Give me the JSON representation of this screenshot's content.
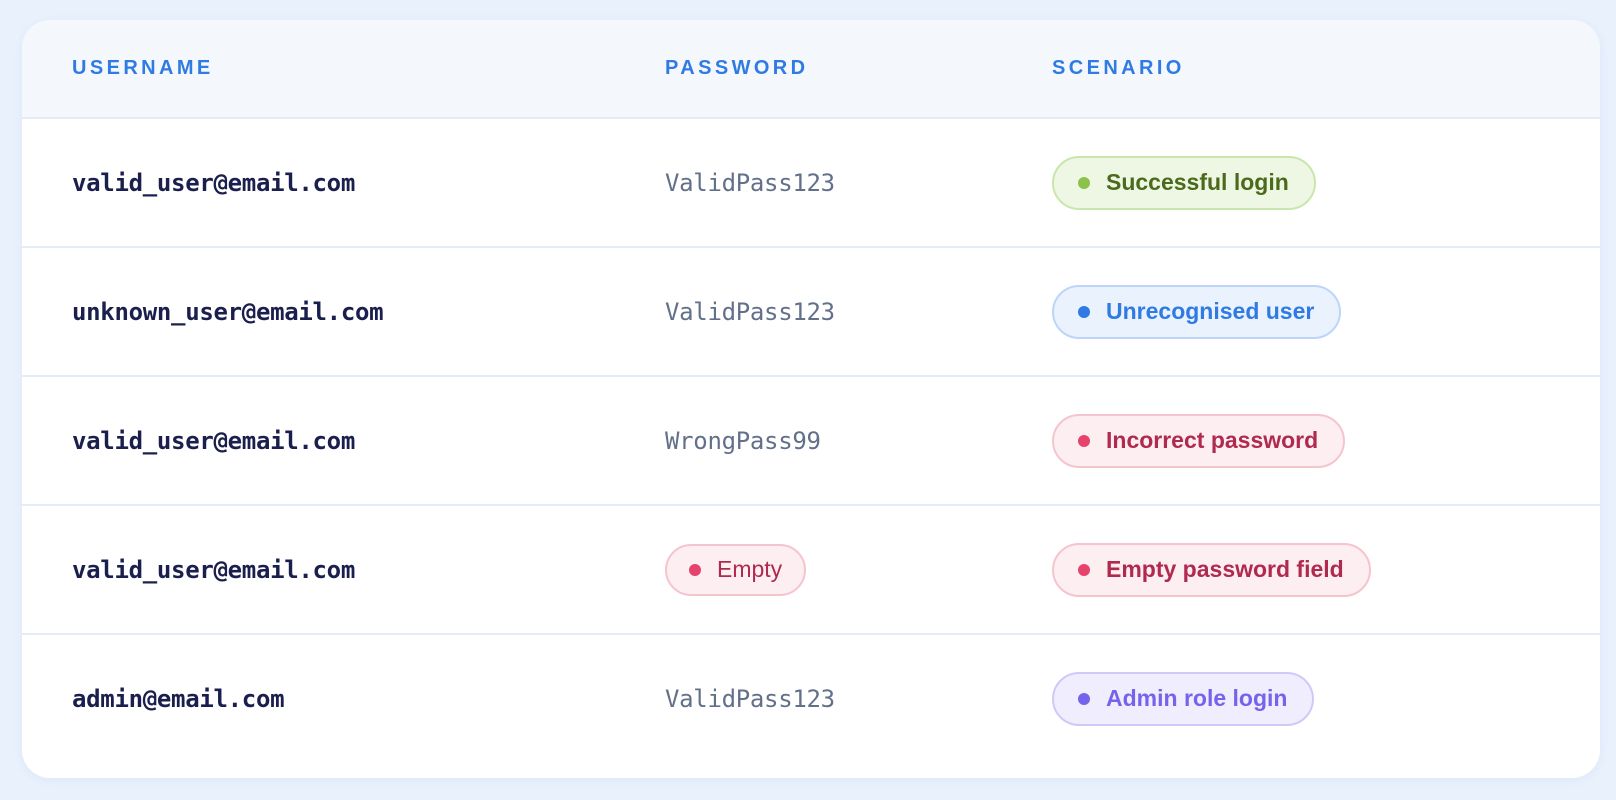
{
  "table": {
    "headers": {
      "username": "USERNAME",
      "password": "PASSWORD",
      "scenario": "SCENARIO"
    },
    "rows": [
      {
        "username": "valid_user@email.com",
        "password": "ValidPass123",
        "scenario": "Successful login",
        "scenario_status": "success"
      },
      {
        "username": "unknown_user@email.com",
        "password": "ValidPass123",
        "scenario": "Unrecognised user",
        "scenario_status": "info"
      },
      {
        "username": "valid_user@email.com",
        "password": "WrongPass99",
        "scenario": "Incorrect password",
        "scenario_status": "error"
      },
      {
        "username": "valid_user@email.com",
        "password_badge": "Empty",
        "scenario": "Empty password field",
        "scenario_status": "error"
      },
      {
        "username": "admin@email.com",
        "password": "ValidPass123",
        "scenario": "Admin role login",
        "scenario_status": "admin"
      }
    ]
  },
  "colors": {
    "page_background": "#e8f1fc",
    "header_text": "#2f7be3",
    "success": "#8cc24a",
    "info": "#2f7be3",
    "error": "#e6426b",
    "admin": "#7563eb"
  }
}
